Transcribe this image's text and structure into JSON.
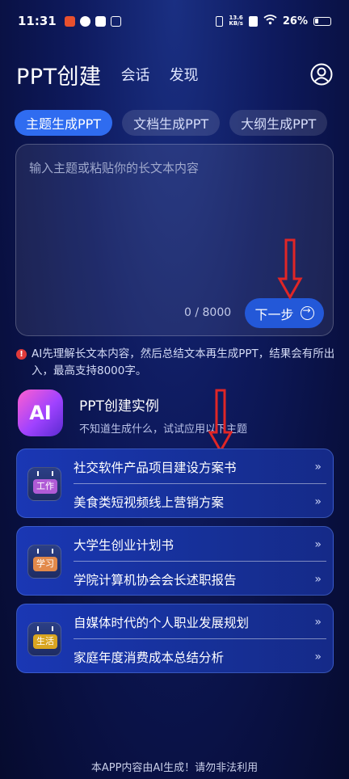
{
  "status_bar": {
    "time": "11:31",
    "net_speed": "13.6",
    "net_unit": "KB/s",
    "battery": "26%"
  },
  "header": {
    "title": "PPT创建",
    "tabs": [
      "会话",
      "发现"
    ]
  },
  "mode_tabs": [
    "主题生成PPT",
    "文档生成PPT",
    "大纲生成PPT"
  ],
  "input": {
    "placeholder": "输入主题或粘贴你的长文本内容",
    "counter": "0 / 8000",
    "next_label": "下一步"
  },
  "notice": "AI先理解长文本内容，然后总结文本再生成PPT，结果会有所出入，最高支持8000字。",
  "examples": {
    "logo_text": "AI",
    "title": "PPT创建实例",
    "subtitle": "不知道生成什么，试试应用以下主题"
  },
  "groups": [
    {
      "tag": "工作",
      "tag_color": "#b05bd6",
      "items": [
        "社交软件产品项目建设方案书",
        "美食类短视频线上营销方案"
      ]
    },
    {
      "tag": "学习",
      "tag_color": "#e2894a",
      "items": [
        "大学生创业计划书",
        "学院计算机协会会长述职报告"
      ]
    },
    {
      "tag": "生活",
      "tag_color": "#d9a521",
      "items": [
        "自媒体时代的个人职业发展规划",
        "家庭年度消费成本总结分析"
      ]
    }
  ],
  "footer": "本APP内容由AI生成！请勿非法利用"
}
